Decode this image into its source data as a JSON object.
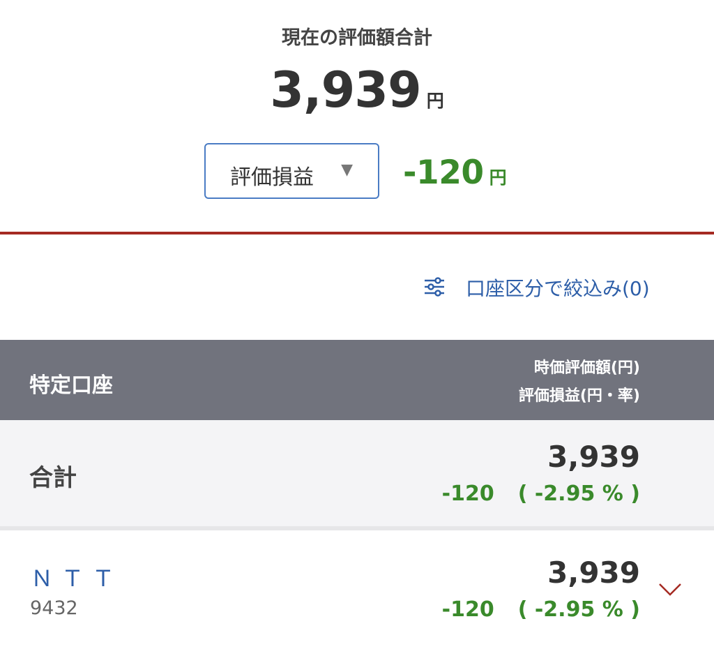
{
  "summary": {
    "title": "現在の評価額合計",
    "total_value": "3,939",
    "total_unit": "円",
    "select_label": "評価損益",
    "select_arrow": "▼",
    "pl_value": "-120",
    "pl_unit": "円"
  },
  "filter": {
    "icon": "sliders-icon",
    "label": "口座区分で絞込み(0)"
  },
  "table": {
    "account_type": "特定口座",
    "col_header_1": "時価評価額(円)",
    "col_header_2": "評価損益(円・率)",
    "total": {
      "label": "合計",
      "amount": "3,939",
      "pl": "-120",
      "rate": "( -2.95 % )"
    },
    "rows": [
      {
        "name": "ＮＴＴ",
        "code": "9432",
        "amount": "3,939",
        "pl": "-120",
        "rate": "( -2.95 % )",
        "expand_icon": "chevron-down-icon"
      }
    ]
  },
  "colors": {
    "accent_blue": "#2d5ea8",
    "loss_green": "#3a8a2b",
    "divider_red": "#a52a22",
    "header_gray": "#71737d"
  }
}
